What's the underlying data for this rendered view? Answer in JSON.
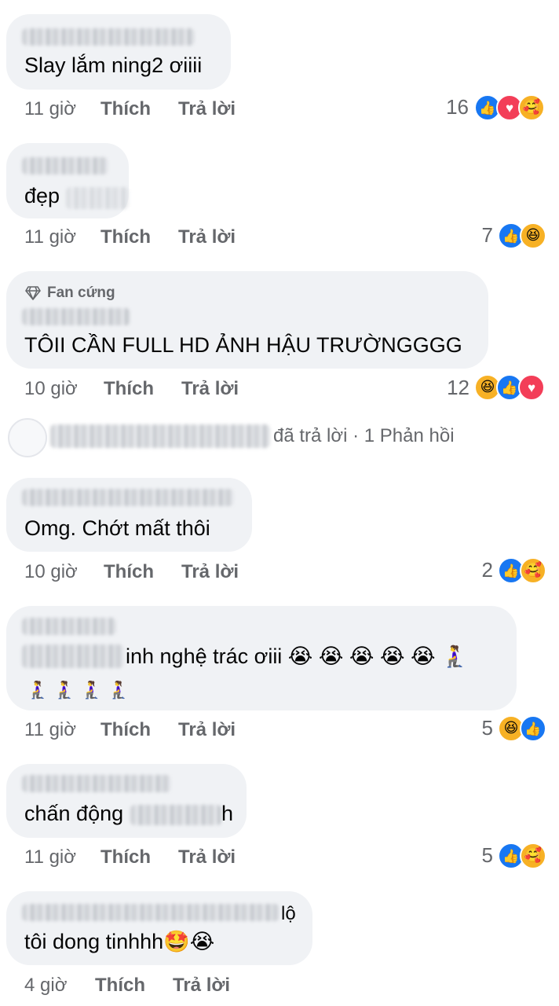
{
  "comments": [
    {
      "text": "Slay lắm ning2 ơiiii",
      "time": "11 giờ",
      "count": "16",
      "reactions": [
        "like",
        "love",
        "care"
      ]
    },
    {
      "text": "đẹp",
      "time": "11 giờ",
      "count": "7",
      "reactions": [
        "like",
        "haha"
      ]
    },
    {
      "badge": "Fan cứng",
      "text": "TÔII CẦN FULL HD ẢNH HẬU TRƯỜNGGGG",
      "time": "10 giờ",
      "count": "12",
      "reactions": [
        "haha",
        "like",
        "love"
      ]
    },
    {
      "text": "Omg. Chớt mất thôi",
      "time": "10 giờ",
      "count": "2",
      "reactions": [
        "like",
        "care"
      ]
    },
    {
      "text": "inh nghệ trác ơiii 😭 😭 😭 😭 😭 🧎‍♀️",
      "text2": "🧎‍♀️ 🧎‍♀️ 🧎‍♀️ 🧎‍♀️",
      "time": "11 giờ",
      "count": "5",
      "reactions": [
        "haha",
        "like"
      ]
    },
    {
      "text": "chấn động",
      "text_tail": "h",
      "time": "11 giờ",
      "count": "5",
      "reactions": [
        "like",
        "care"
      ]
    },
    {
      "name_tail": "lộ",
      "text": "tôi dong tinhhh🤩😭",
      "time": "4 giờ"
    }
  ],
  "labels": {
    "like": "Thích",
    "reply": "Trả lời"
  },
  "replies": {
    "replied_text": "đã trả lời",
    "count_text": "· 1 Phản hồi"
  },
  "icons": {
    "like": "thumbs-up-icon",
    "love": "heart-icon",
    "haha": "laughing-face-icon",
    "care": "hugging-face-icon",
    "badge": "diamond-icon"
  },
  "colors": {
    "like": "#1877f2",
    "love": "#f33e58",
    "emoji": "#f7b125",
    "meta": "#65676b",
    "bubble": "#f0f2f5"
  }
}
